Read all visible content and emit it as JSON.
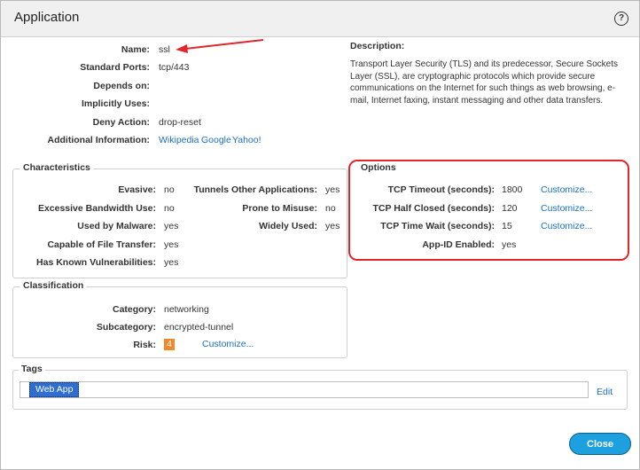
{
  "dialog": {
    "title": "Application"
  },
  "general": {
    "name_label": "Name:",
    "name_value": "ssl",
    "ports_label": "Standard Ports:",
    "ports_value": "tcp/443",
    "depends_label": "Depends on:",
    "implicit_label": "Implicitly Uses:",
    "deny_label": "Deny Action:",
    "deny_value": "drop-reset",
    "addinfo_label": "Additional Information:",
    "links": [
      "Wikipedia",
      "Google",
      "Yahoo!"
    ]
  },
  "description": {
    "label": "Description:",
    "text": "Transport Layer Security (TLS) and its predecessor, Secure Sockets Layer (SSL), are cryptographic protocols which provide secure communications on the Internet for such things as web browsing, e-mail, Internet faxing, instant messaging and other data transfers."
  },
  "characteristics": {
    "legend": "Characteristics",
    "left": [
      {
        "label": "Evasive:",
        "value": "no"
      },
      {
        "label": "Excessive Bandwidth Use:",
        "value": "no"
      },
      {
        "label": "Used by Malware:",
        "value": "yes"
      },
      {
        "label": "Capable of File Transfer:",
        "value": "yes"
      },
      {
        "label": "Has Known Vulnerabilities:",
        "value": "yes"
      }
    ],
    "right": [
      {
        "label": "Tunnels Other Applications:",
        "value": "yes"
      },
      {
        "label": "Prone to Misuse:",
        "value": "no"
      },
      {
        "label": "Widely Used:",
        "value": "yes"
      }
    ]
  },
  "options": {
    "legend": "Options",
    "rows": [
      {
        "label": "TCP Timeout (seconds):",
        "value": "1800",
        "link": "Customize..."
      },
      {
        "label": "TCP Half Closed (seconds):",
        "value": "120",
        "link": "Customize..."
      },
      {
        "label": "TCP Time Wait (seconds):",
        "value": "15",
        "link": "Customize..."
      },
      {
        "label": "App-ID Enabled:",
        "value": "yes"
      }
    ]
  },
  "classification": {
    "legend": "Classification",
    "category_label": "Category:",
    "category_value": "networking",
    "subcategory_label": "Subcategory:",
    "subcategory_value": "encrypted-tunnel",
    "risk_label": "Risk:",
    "risk_value": "4",
    "risk_link": "Customize..."
  },
  "tags": {
    "legend": "Tags",
    "tag": "Web App",
    "edit": "Edit"
  },
  "footer": {
    "close": "Close"
  },
  "colors": {
    "accent": "#1ca0e0",
    "link": "#1a6fc2",
    "risk": "#f0892b",
    "highlight": "#e0262d",
    "tag": "#2d6ecf"
  }
}
